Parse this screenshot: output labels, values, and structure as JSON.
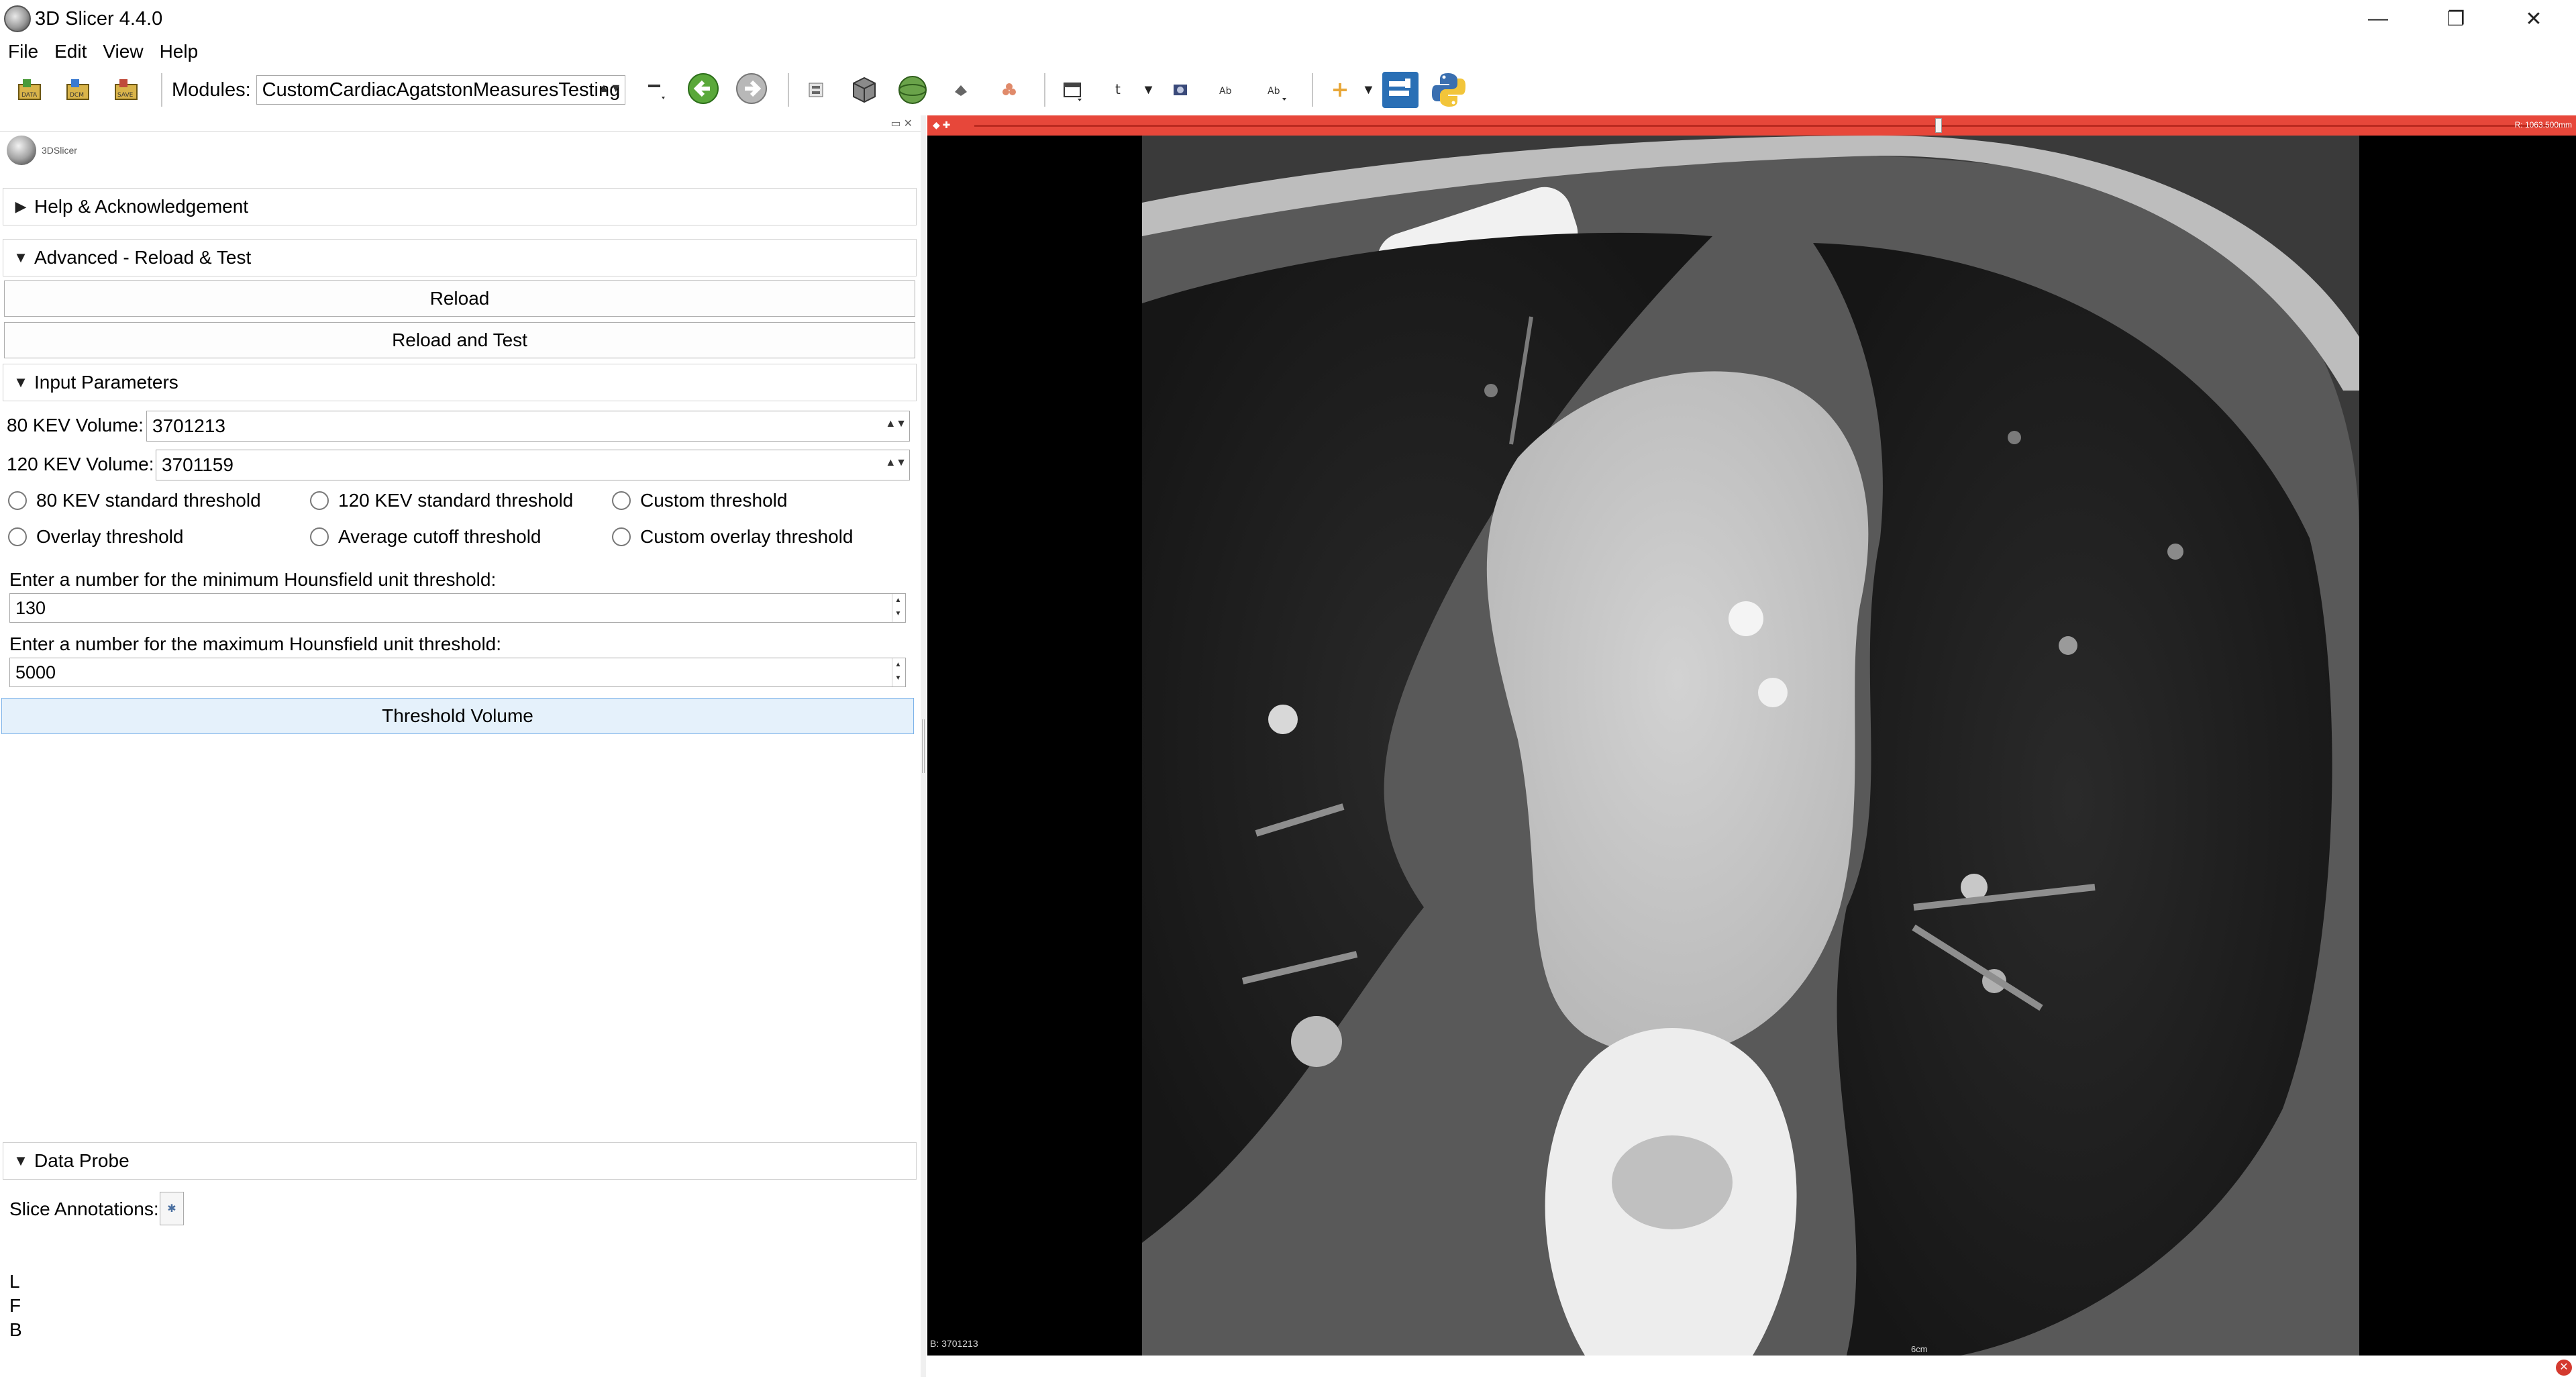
{
  "window": {
    "title": "3D Slicer 4.4.0",
    "controls": {
      "minimize": "—",
      "restore": "❐",
      "close": "✕"
    }
  },
  "menu": {
    "items": [
      "File",
      "Edit",
      "View",
      "Help"
    ]
  },
  "toolbar": {
    "modules_label": "Modules:",
    "module_selected": "CustomCardiacAgatstonMeasuresTesting",
    "buttons": [
      "data-icon",
      "dcm-icon",
      "save-icon",
      "module-list-icon",
      "back-arrow-icon",
      "forward-arrow-icon",
      "extension-icon",
      "cube-icon",
      "sphere-icon",
      "shape-icon",
      "shape2-icon",
      "layout-icon",
      "crosshair-icon",
      "camera-icon",
      "screenshot-icon",
      "link-icon",
      "fiducial-icon",
      "extension-manager-icon",
      "python-icon"
    ]
  },
  "panel": {
    "logo_text": "3DSlicer",
    "sections": {
      "help": "Help & Acknowledgement",
      "advanced": "Advanced - Reload & Test",
      "input": "Input Parameters",
      "probe": "Data Probe"
    },
    "buttons": {
      "reload": "Reload",
      "reload_test": "Reload and Test",
      "threshold_volume": "Threshold Volume"
    },
    "inputs": {
      "kev80_label": "80 KEV Volume:",
      "kev80_value": "3701213",
      "kev120_label": "120 KEV Volume:",
      "kev120_value": "3701159",
      "min_label": "Enter a number for the minimum Hounsfield unit threshold:",
      "min_value": "130",
      "max_label": "Enter a number for the maximum Hounsfield unit threshold:",
      "max_value": "5000"
    },
    "radios": [
      "80 KEV standard threshold",
      "120 KEV standard threshold",
      "Custom threshold",
      "Overlay threshold",
      "Average cutoff threshold",
      "Custom overlay threshold"
    ],
    "probe": {
      "slice_annotations_label": "Slice Annotations:",
      "lines": [
        "L",
        "F",
        "B"
      ]
    }
  },
  "viewer": {
    "offset_text": "R: 1063.500mm",
    "corner_text": "B: 3701213",
    "ruler_text": "6cm",
    "colors": {
      "slice_bar": "#e7473a",
      "background": "#000000"
    }
  }
}
